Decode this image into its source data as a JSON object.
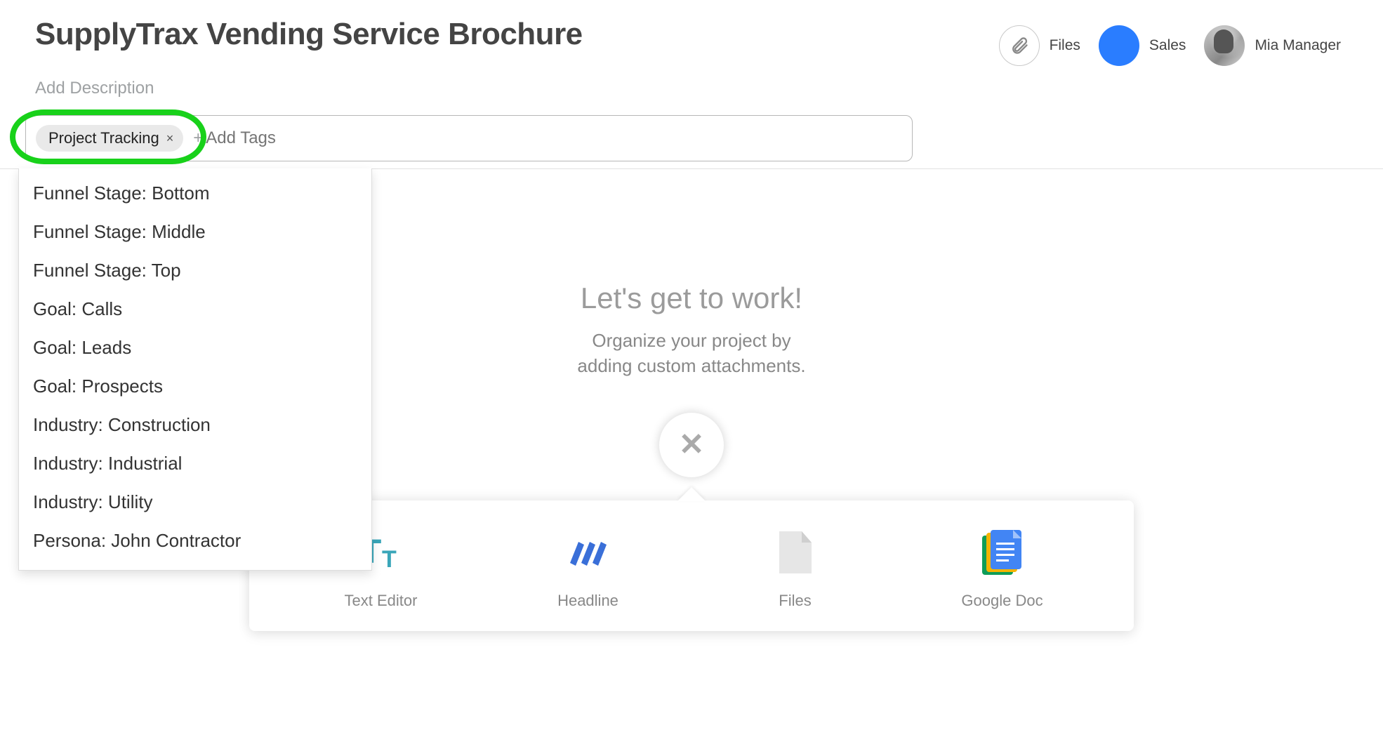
{
  "header": {
    "title": "SupplyTrax Vending Service Brochure",
    "files_label": "Files",
    "sales_label": "Sales",
    "user_name": "Mia Manager"
  },
  "description": {
    "placeholder": "Add Description"
  },
  "tags": {
    "selected": "Project Tracking",
    "remove_glyph": "×",
    "add_prefix": "+",
    "add_placeholder": "Add Tags",
    "suggestions": [
      "Funnel Stage: Bottom",
      "Funnel Stage: Middle",
      "Funnel Stage: Top",
      "Goal: Calls",
      "Goal: Leads",
      "Goal: Prospects",
      "Industry: Construction",
      "Industry: Industrial",
      "Industry: Utility",
      "Persona: John Contractor"
    ]
  },
  "empty_state": {
    "title": "Let's get to work!",
    "subtitle_line1": "Organize your project by",
    "subtitle_line2": "adding custom attachments."
  },
  "attachments": {
    "items": [
      {
        "label": "Text Editor"
      },
      {
        "label": "Headline"
      },
      {
        "label": "Files"
      },
      {
        "label": "Google Doc"
      }
    ]
  }
}
